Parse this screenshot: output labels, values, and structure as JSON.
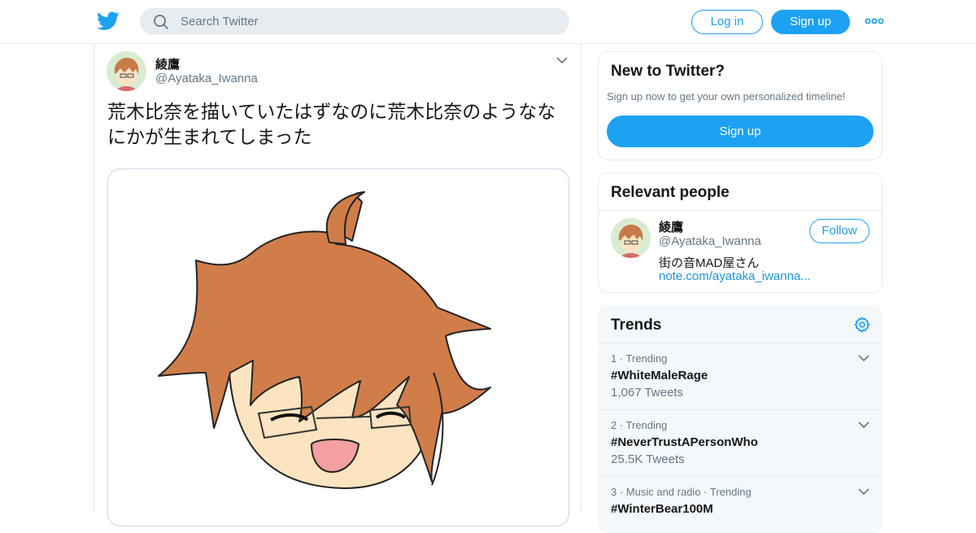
{
  "search": {
    "placeholder": "Search Twitter"
  },
  "header": {
    "login_label": "Log in",
    "signup_label": "Sign up"
  },
  "tweet": {
    "name": "綾鷹",
    "handle": "@Ayataka_Iwanna",
    "text": "荒木比奈を描いていたはずなのに荒木比奈のようななにかが生まれてしまった"
  },
  "new_to_twitter": {
    "title": "New to Twitter?",
    "subtitle": "Sign up now to get your own personalized timeline!",
    "button": "Sign up"
  },
  "relevant": {
    "title": "Relevant people",
    "name": "綾鷹",
    "handle": "@Ayataka_Iwanna",
    "bio": "街の音MAD屋さん",
    "link": "note.com/ayataka_iwanna...",
    "follow_label": "Follow"
  },
  "trends": {
    "title": "Trends",
    "items": [
      {
        "meta": "1 · Trending",
        "name": "#WhiteMaleRage",
        "count": "1,067 Tweets"
      },
      {
        "meta": "2 · Trending",
        "name": "#NeverTrustAPersonWho",
        "count": "25.5K Tweets"
      },
      {
        "meta": "3 · Music and radio · Trending",
        "name": "#WinterBear100M",
        "count": ""
      }
    ]
  },
  "colors": {
    "accent": "#1da1f2",
    "muted": "#657786",
    "border": "#e6ecf0"
  }
}
